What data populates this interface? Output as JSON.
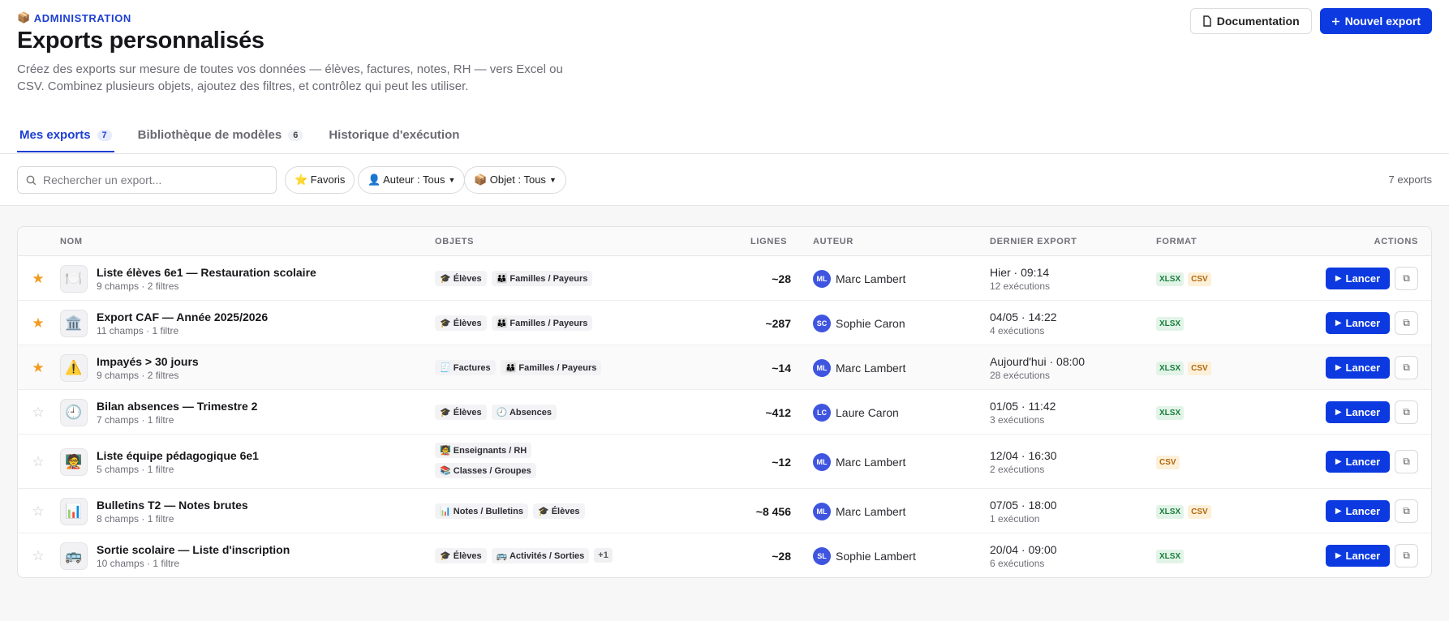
{
  "header": {
    "eyebrow_icon": "📦",
    "eyebrow": "ADMINISTRATION",
    "title": "Exports personnalisés",
    "description": "Créez des exports sur mesure de toutes vos données — élèves, factures, notes, RH — vers Excel ou CSV. Combinez plusieurs objets, ajoutez des filtres, et contrôlez qui peut les utiliser.",
    "doc_label": "Documentation",
    "new_label": "Nouvel export"
  },
  "tabs": [
    {
      "label": "Mes exports",
      "count": "7"
    },
    {
      "label": "Bibliothèque de modèles",
      "count": "6"
    },
    {
      "label": "Historique d'exécution"
    }
  ],
  "toolbar": {
    "search_placeholder": "Rechercher un export...",
    "favorites": "⭐ Favoris",
    "author_filter": "👤 Auteur : Tous",
    "object_filter": "📦 Objet : Tous",
    "count": "7 exports"
  },
  "columns": {
    "name": "NOM",
    "objects": "OBJETS",
    "rows": "LIGNES",
    "author": "AUTEUR",
    "last": "DERNIER EXPORT",
    "format": "FORMAT",
    "actions": "ACTIONS"
  },
  "run_label": "Lancer",
  "rows": [
    {
      "fav": true,
      "icon": "🍽️",
      "name": "Liste élèves 6e1 — Restauration scolaire",
      "sub": "9 champs · 2 filtres",
      "objects": [
        "🎓 Élèves",
        "👪 Familles / Payeurs"
      ],
      "more": "",
      "lignes": "~28",
      "initials": "ML",
      "author": "Marc Lambert",
      "last": "Hier · 09:14",
      "runs": "12 exécutions",
      "formats": [
        "XLSX",
        "CSV"
      ]
    },
    {
      "fav": true,
      "icon": "🏛️",
      "name": "Export CAF — Année 2025/2026",
      "sub": "11 champs · 1 filtre",
      "objects": [
        "🎓 Élèves",
        "👪 Familles / Payeurs"
      ],
      "more": "",
      "lignes": "~287",
      "initials": "SC",
      "author": "Sophie Caron",
      "last": "04/05 · 14:22",
      "runs": "4 exécutions",
      "formats": [
        "XLSX"
      ]
    },
    {
      "fav": true,
      "icon": "⚠️",
      "name": "Impayés > 30 jours",
      "sub": "9 champs · 2 filtres",
      "objects": [
        "🧾 Factures",
        "👪 Familles / Payeurs"
      ],
      "more": "",
      "lignes": "~14",
      "initials": "ML",
      "author": "Marc Lambert",
      "last": "Aujourd'hui · 08:00",
      "runs": "28 exécutions",
      "formats": [
        "XLSX",
        "CSV"
      ]
    },
    {
      "fav": false,
      "icon": "🕘",
      "name": "Bilan absences — Trimestre 2",
      "sub": "7 champs · 1 filtre",
      "objects": [
        "🎓 Élèves",
        "🕘 Absences"
      ],
      "more": "",
      "lignes": "~412",
      "initials": "LC",
      "author": "Laure Caron",
      "last": "01/05 · 11:42",
      "runs": "3 exécutions",
      "formats": [
        "XLSX"
      ]
    },
    {
      "fav": false,
      "icon": "🧑‍🏫",
      "name": "Liste équipe pédagogique 6e1",
      "sub": "5 champs · 1 filtre",
      "objects": [
        "🧑‍🏫 Enseignants / RH",
        "📚 Classes / Groupes"
      ],
      "more": "",
      "lignes": "~12",
      "initials": "ML",
      "author": "Marc Lambert",
      "last": "12/04 · 16:30",
      "runs": "2 exécutions",
      "formats": [
        "CSV"
      ]
    },
    {
      "fav": false,
      "icon": "📊",
      "name": "Bulletins T2 — Notes brutes",
      "sub": "8 champs · 1 filtre",
      "objects": [
        "📊 Notes / Bulletins",
        "🎓 Élèves"
      ],
      "more": "",
      "lignes": "~8 456",
      "initials": "ML",
      "author": "Marc Lambert",
      "last": "07/05 · 18:00",
      "runs": "1 exécution",
      "formats": [
        "XLSX",
        "CSV"
      ]
    },
    {
      "fav": false,
      "icon": "🚌",
      "name": "Sortie scolaire — Liste d'inscription",
      "sub": "10 champs · 1 filtre",
      "objects": [
        "🎓 Élèves",
        "🚌 Activités / Sorties"
      ],
      "more": "+1",
      "lignes": "~28",
      "initials": "SL",
      "author": "Sophie Lambert",
      "last": "20/04 · 09:00",
      "runs": "6 exécutions",
      "formats": [
        "XLSX"
      ]
    }
  ]
}
